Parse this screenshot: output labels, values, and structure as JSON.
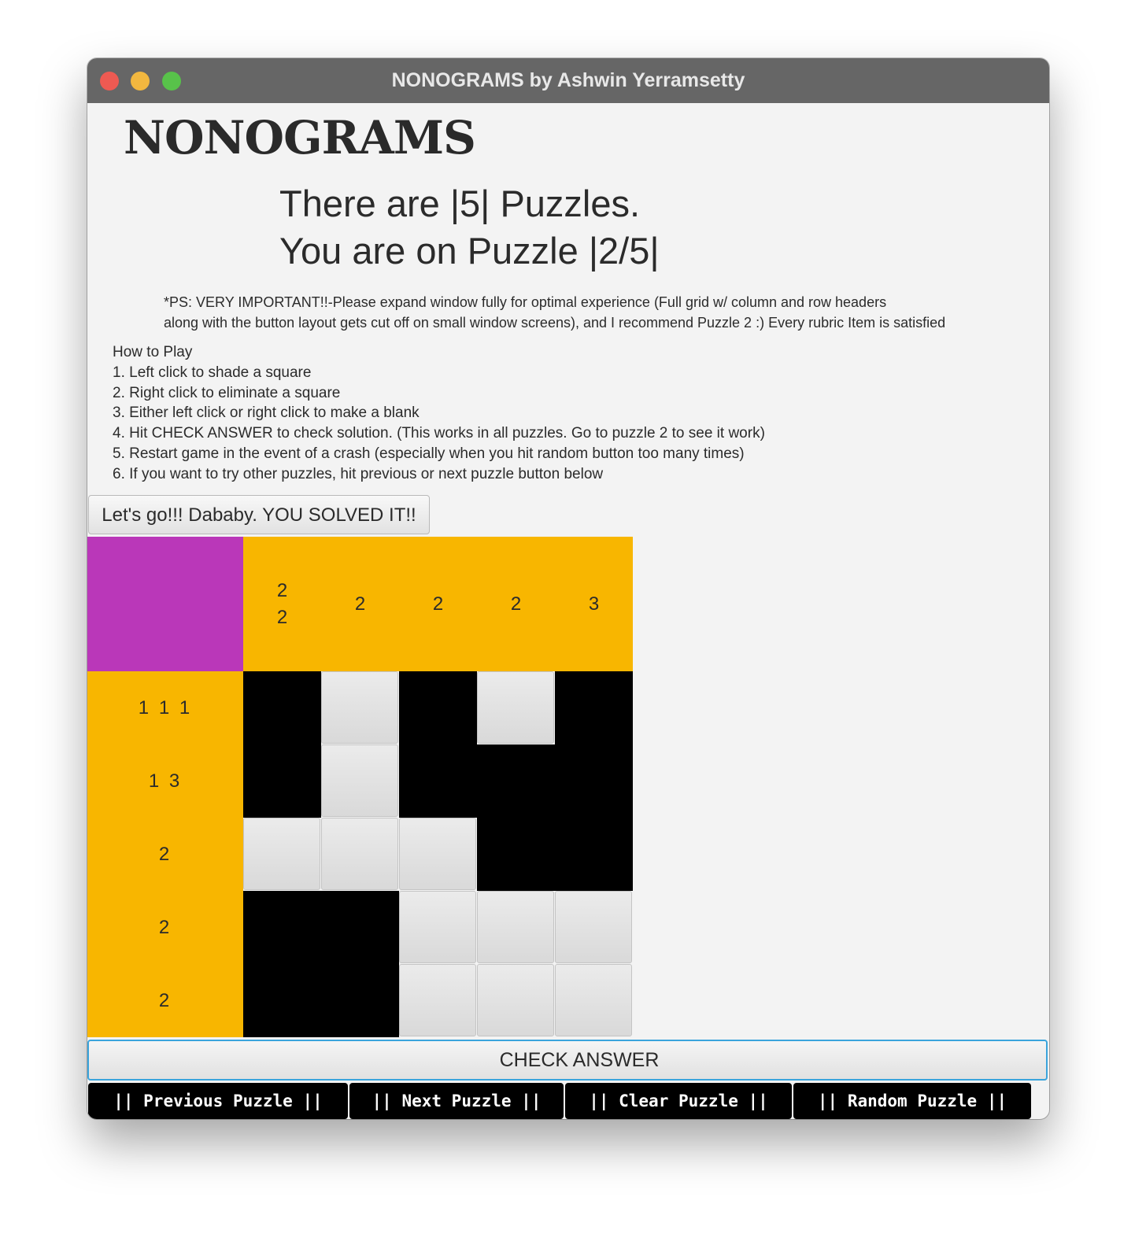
{
  "window": {
    "title": "NONOGRAMS by Ashwin Yerramsetty"
  },
  "header": {
    "app_title": "NONOGRAMS",
    "count_line": "There are |5| Puzzles.",
    "current_line": "You are on Puzzle |2/5|"
  },
  "note": {
    "line1": "*PS: VERY IMPORTANT!!-Please expand window fully for optimal experience (Full grid w/ column and row headers",
    "line2": "along with the button layout gets cut off on small window screens), and I recommend Puzzle 2 :) Every rubric Item is satisfied"
  },
  "howto": {
    "title": "How to Play",
    "steps": [
      "1. Left click to shade a square",
      "2. Right click to eliminate a square",
      "3. Either left click or right click to make a blank",
      "4. Hit CHECK ANSWER to check solution. (This works in all puzzles. Go to puzzle 2 to see it work)",
      "5. Restart game in the event of a crash (especially when you hit random button too many times)",
      "6. If you want to try other puzzles, hit previous or next puzzle button below"
    ]
  },
  "status_button": "Let's go!!! Dababy. YOU SOLVED IT!!",
  "puzzle": {
    "column_clues": [
      [
        "2",
        "2"
      ],
      [
        "2"
      ],
      [
        "2"
      ],
      [
        "2"
      ],
      [
        "3"
      ]
    ],
    "row_clues": [
      "1 1 1",
      "1 3",
      "2",
      "2",
      "2"
    ],
    "grid": [
      [
        1,
        0,
        1,
        0,
        1
      ],
      [
        1,
        0,
        1,
        1,
        1
      ],
      [
        0,
        0,
        0,
        1,
        1
      ],
      [
        1,
        1,
        0,
        0,
        0
      ],
      [
        1,
        1,
        0,
        0,
        0
      ]
    ]
  },
  "check_button": "CHECK ANSWER",
  "nav_buttons": {
    "previous": "|| Previous Puzzle ||",
    "next": "|| Next Puzzle ||",
    "clear": "|| Clear Puzzle ||",
    "random": "|| Random Puzzle ||"
  },
  "colors": {
    "clue_bg": "#f8b600",
    "corner_bg": "#ba37b9",
    "filled": "#000000",
    "blank": "#e2e2e2",
    "check_border": "#3aa4dc"
  }
}
